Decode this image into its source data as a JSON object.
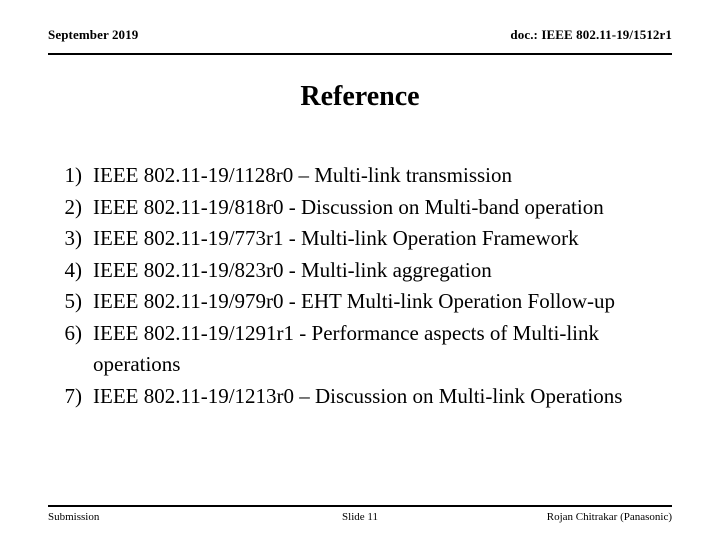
{
  "header": {
    "date": "September 2019",
    "doc_id": "doc.: IEEE 802.11-19/1512r1"
  },
  "title": "Reference",
  "references": {
    "items": [
      {
        "marker": "1)",
        "text": "IEEE 802.11-19/1128r0 – Multi-link transmission"
      },
      {
        "marker": "2)",
        "text": "IEEE 802.11-19/818r0 - Discussion on Multi-band operation"
      },
      {
        "marker": "3)",
        "text": "IEEE 802.11-19/773r1 - Multi-link Operation Framework"
      },
      {
        "marker": "4)",
        "text": "IEEE 802.11-19/823r0 - Multi-link aggregation"
      },
      {
        "marker": "5)",
        "text": "IEEE 802.11-19/979r0 - EHT Multi-link Operation Follow-up"
      },
      {
        "marker": "6)",
        "text": "IEEE 802.11-19/1291r1 - Performance aspects of Multi-link operations"
      },
      {
        "marker": "7)",
        "text": "IEEE 802.11-19/1213r0 – Discussion on Multi-link Operations"
      }
    ]
  },
  "footer": {
    "left": "Submission",
    "center": "Slide 11",
    "right": "Rojan Chitrakar (Panasonic)"
  },
  "colors": {
    "background": "#ffffff",
    "text": "#000000",
    "rule": "#000000"
  }
}
